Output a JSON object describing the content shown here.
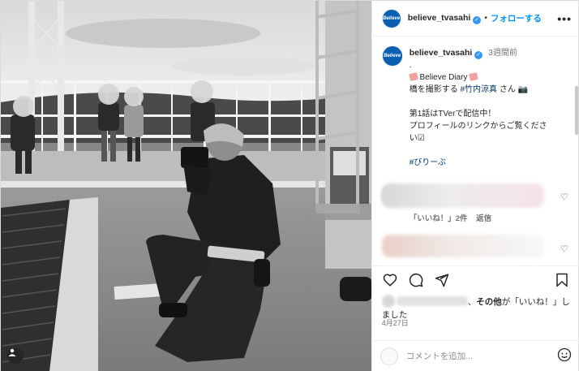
{
  "post": {
    "username": "believe_tvasahi",
    "avatar_text": "Believe",
    "follow_label": "フォローする",
    "more_label": "•••",
    "time_ago": "3週間前"
  },
  "caption": {
    "line0": ".",
    "line1_text": "Believe Diary",
    "line2_prefix": "橋を撮影する",
    "line2_tag": "#竹内涼真",
    "line2_suffix": "さん",
    "line3": "",
    "line4": "第1話はTVerで配信中！",
    "line5": "プロフィールのリンクからご覧くださ",
    "line6": "い☑",
    "line7": "",
    "line8_tag": "#びりーぶ"
  },
  "comment1_meta": {
    "likes": "「いいね！」2件",
    "reply": "返信"
  },
  "likes_text": {
    "middle": "、",
    "bold": "その他",
    "suffix": "が「いいね！」し",
    "line2": "ました"
  },
  "date": "4月27日",
  "comment_box": {
    "placeholder": "コメントを追加..."
  },
  "icons": [
    "verified-badge-icon",
    "heart-icon",
    "comment-icon",
    "share-icon",
    "bookmark-icon",
    "emoji-icon",
    "user-tag-icon"
  ],
  "colors": {
    "accent": "#0095f6",
    "verified": "#3897f0",
    "link": "#00376b",
    "text": "#262626",
    "muted": "#737373",
    "avatar_bg": "#0b5fb0"
  }
}
